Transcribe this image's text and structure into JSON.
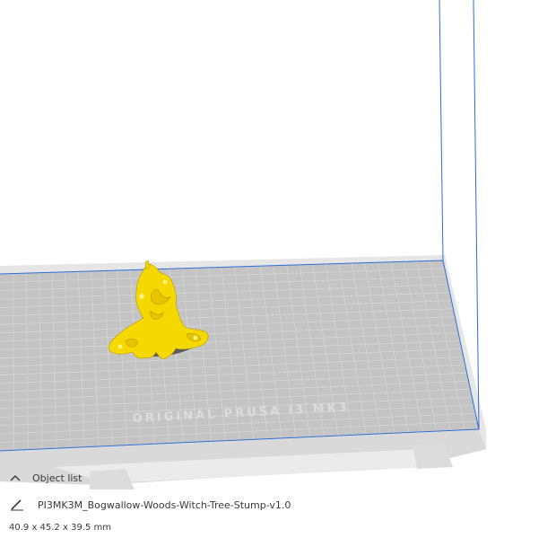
{
  "object_list": {
    "toggle_label": "Object list",
    "object_name": "PI3MK3M_Bogwallow-Woods-Witch-Tree-Stump-v1.0",
    "dimensions": "40.9 x 45.2 x 39.5 mm"
  },
  "viewport": {
    "bed_watermark": "ORIGINAL PRUSA i3 MK3",
    "model_color": "#f5d800",
    "bed_color": "#c4c4c4",
    "volume_outline_color": "#2d6fd6"
  },
  "icons": {
    "collapse": "chevron-up-icon",
    "edit": "pencil-icon"
  }
}
